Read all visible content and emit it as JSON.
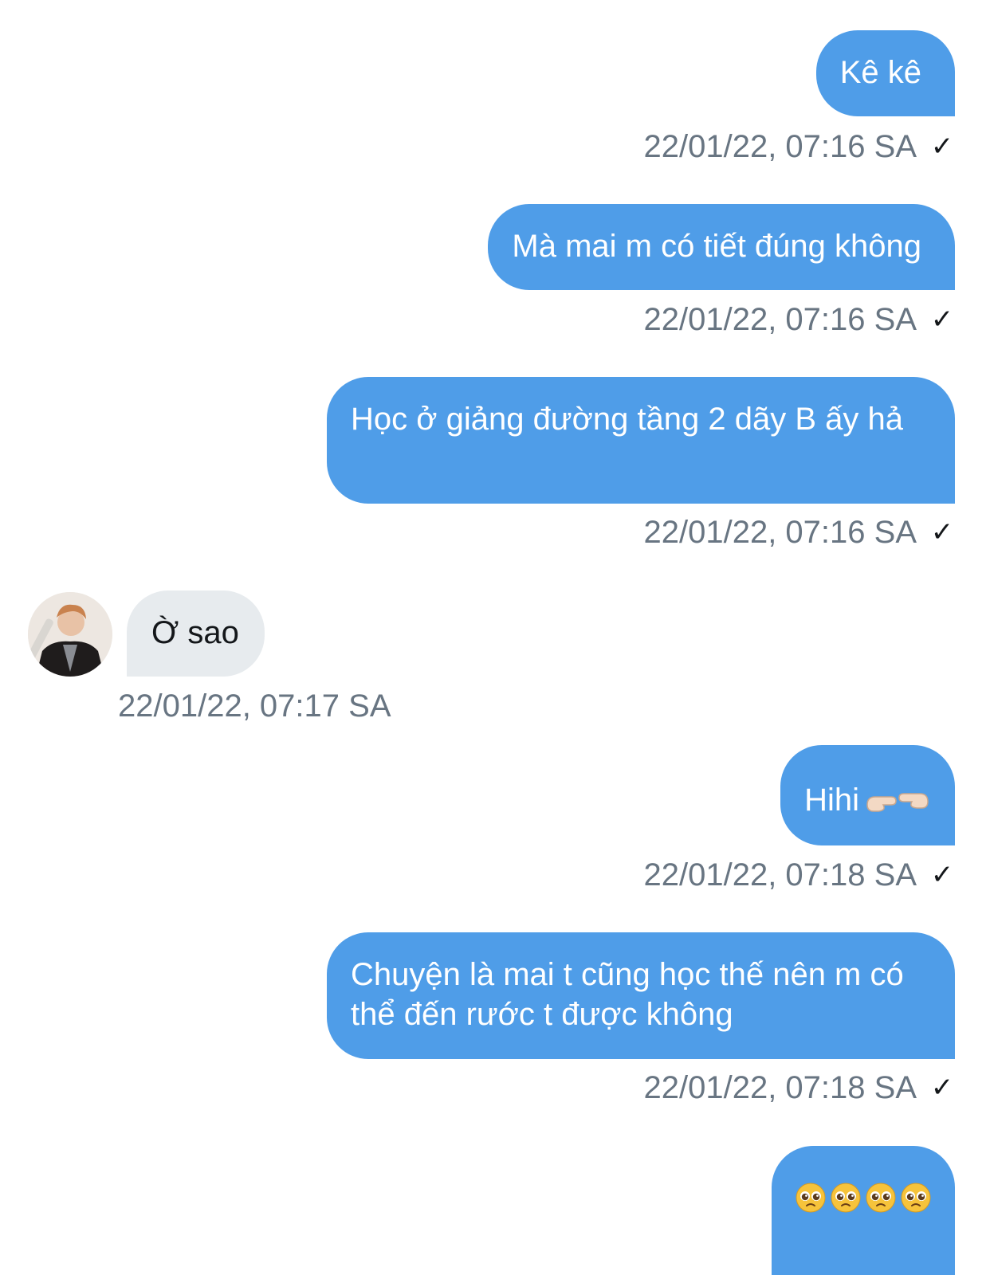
{
  "messages": [
    {
      "direction": "outgoing",
      "text": "Kê kê",
      "timestamp": "22/01/22, 07:16 SA",
      "status_icon": "check-icon"
    },
    {
      "direction": "outgoing",
      "text": "Mà mai m có tiết đúng không",
      "timestamp": "22/01/22, 07:16 SA",
      "status_icon": "check-icon"
    },
    {
      "direction": "outgoing",
      "text": "Học ở giảng đường tầng 2 dãy B ấy hả",
      "timestamp": "22/01/22, 07:16 SA",
      "status_icon": "check-icon"
    },
    {
      "direction": "incoming",
      "text": "Ờ sao",
      "timestamp": "22/01/22, 07:17 SA",
      "avatar_icon": "contact-avatar"
    },
    {
      "direction": "outgoing",
      "text": "Hihi",
      "emoji": "fingers-pointing-together-icon",
      "timestamp": "22/01/22, 07:18 SA",
      "status_icon": "check-icon"
    },
    {
      "direction": "outgoing",
      "text": "Chuyện là mai t cũng học thế nên m có thể đến rước t được không",
      "timestamp": "22/01/22, 07:18 SA",
      "status_icon": "check-icon"
    },
    {
      "direction": "outgoing",
      "emoji": "pleading-face-icon",
      "emoji_count": 4
    }
  ],
  "icons": {
    "check": "✓"
  },
  "colors": {
    "outgoing_bubble": "#4f9de8",
    "incoming_bubble": "#e7ebee",
    "timestamp_text": "#687582"
  }
}
